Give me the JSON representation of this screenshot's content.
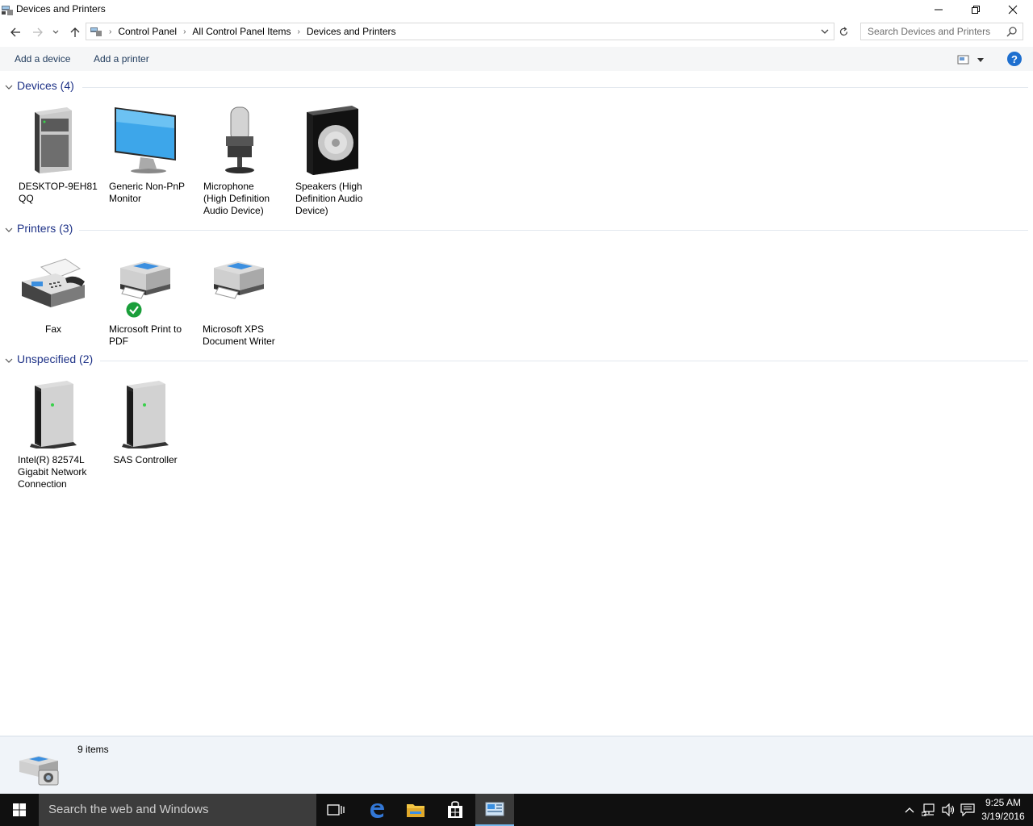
{
  "window": {
    "title": "Devices and Printers"
  },
  "address": {
    "crumbs": [
      "Control Panel",
      "All Control Panel Items",
      "Devices and Printers"
    ]
  },
  "search": {
    "placeholder": "Search Devices and Printers"
  },
  "commands": {
    "add_device": "Add a device",
    "add_printer": "Add a printer",
    "help": "?"
  },
  "groups": {
    "devices": {
      "label": "Devices (4)",
      "items": [
        {
          "name_line1": "DESKTOP-9EH81",
          "name_line2": "QQ",
          "name_line3": "",
          "icon": "computer-tower-icon"
        },
        {
          "name_line1": "Generic Non-PnP",
          "name_line2": "Monitor",
          "name_line3": "",
          "icon": "monitor-icon"
        },
        {
          "name_line1": "Microphone",
          "name_line2": "(High Definition",
          "name_line3": "Audio Device)",
          "icon": "microphone-icon"
        },
        {
          "name_line1": "Speakers (High",
          "name_line2": "Definition Audio",
          "name_line3": "Device)",
          "icon": "speaker-icon"
        }
      ]
    },
    "printers": {
      "label": "Printers (3)",
      "items": [
        {
          "name_line1": "Fax",
          "name_line2": "",
          "name_line3": "",
          "icon": "fax-icon"
        },
        {
          "name_line1": "Microsoft Print to",
          "name_line2": "PDF",
          "name_line3": "",
          "icon": "printer-icon",
          "default": true
        },
        {
          "name_line1": "Microsoft XPS",
          "name_line2": "Document Writer",
          "name_line3": "",
          "icon": "printer-icon"
        }
      ]
    },
    "unspecified": {
      "label": "Unspecified (2)",
      "items": [
        {
          "name_line1": "Intel(R) 82574L",
          "name_line2": "Gigabit Network",
          "name_line3": "Connection",
          "icon": "device-box-icon"
        },
        {
          "name_line1": "SAS Controller",
          "name_line2": "",
          "name_line3": "",
          "icon": "device-box-icon"
        }
      ]
    }
  },
  "details": {
    "count": "9 items"
  },
  "taskbar": {
    "search_placeholder": "Search the web and Windows",
    "time": "9:25 AM",
    "date": "3/19/2016"
  },
  "colors": {
    "group_header": "#1e3287",
    "command_text": "#1e395b",
    "taskbar_bg": "#101010",
    "accent": "#76b9ed"
  }
}
